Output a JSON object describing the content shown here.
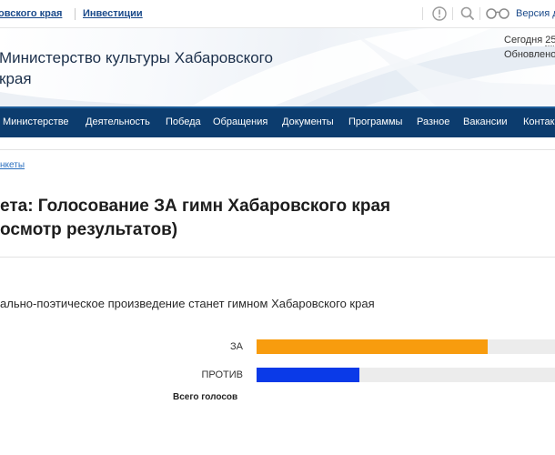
{
  "topbar": {
    "link_region": "овского края",
    "link_invest": "Инвестиции",
    "version_label": "Версия д",
    "icons": [
      "info-icon",
      "search-icon",
      "glasses-icon"
    ]
  },
  "header": {
    "title_line1": "Министерство культуры Хабаровского",
    "title_line2": "края",
    "today_label": "Сегодня",
    "today_value": "25",
    "updated_label": "Обновлено"
  },
  "nav": {
    "items": [
      "Министерстве",
      "Деятельность",
      "Победа",
      "Обращения",
      "Документы",
      "Программы",
      "Разное",
      "Вакансии",
      "Контак"
    ]
  },
  "breadcrumb": {
    "label": "нкеты"
  },
  "page": {
    "title_line1": "ета: Голосование ЗА гимн Хабаровского края",
    "title_line2": "осмотр результатов)"
  },
  "poll": {
    "question": "ально-поэтическое произведение станет гимном Хабаровского края",
    "options": [
      {
        "label": "ЗА",
        "fraction": 0.775,
        "color": "#f89c0e"
      },
      {
        "label": "ПРОТИВ",
        "fraction": 0.345,
        "color": "#0a3ae8"
      }
    ],
    "total_label": "Всего голосов"
  },
  "colors": {
    "nav_bg": "#0c3c6e",
    "link": "#1a4a8a",
    "accent_orange": "#f89c0e",
    "accent_blue": "#0a3ae8"
  }
}
